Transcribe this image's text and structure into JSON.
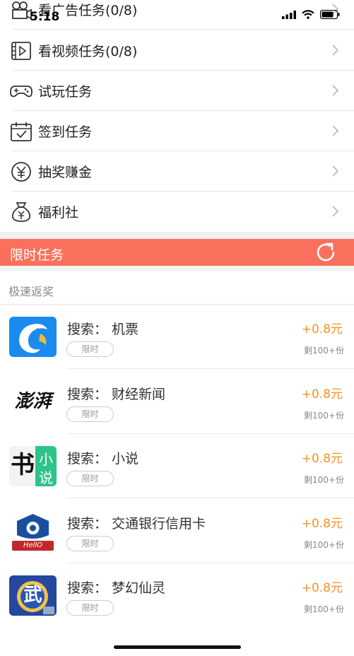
{
  "status_bar": {
    "time": "5:18"
  },
  "tasks": [
    {
      "label": "看广告任务(0/8)",
      "icon": "camera-icon"
    },
    {
      "label": "看视频任务(0/8)",
      "icon": "video-icon"
    },
    {
      "label": "试玩任务",
      "icon": "gamepad-icon"
    },
    {
      "label": "签到任务",
      "icon": "calendar-check-icon"
    },
    {
      "label": "抽奖赚金",
      "icon": "yen-coin-icon"
    },
    {
      "label": "福利社",
      "icon": "money-bag-icon"
    }
  ],
  "limited": {
    "title": "限时任务"
  },
  "section": {
    "label": "极速返奖"
  },
  "offers": [
    {
      "title": "搜索：  机票",
      "tag": "限时",
      "reward": "+0.8元",
      "remaining": "剩100+份",
      "icon": "dolphin-app-icon"
    },
    {
      "title": "搜索：  财经新闻",
      "tag": "限时",
      "reward": "+0.8元",
      "remaining": "剩100+份",
      "icon": "pengpai-app-icon",
      "icon_text": "澎湃"
    },
    {
      "title": "搜索：  小说",
      "tag": "限时",
      "reward": "+0.8元",
      "remaining": "剩100+份",
      "icon": "novel-app-icon",
      "icon_text": [
        "书",
        "小",
        "说"
      ]
    },
    {
      "title": "搜索：  交通银行信用卡",
      "tag": "限时",
      "reward": "+0.8元",
      "remaining": "剩100+份",
      "icon": "bank-app-icon",
      "icon_text": "HellO"
    },
    {
      "title": "搜索：  梦幻仙灵",
      "tag": "限时",
      "reward": "+0.8元",
      "remaining": "剩100+份",
      "icon": "game-app-icon",
      "icon_text": "武"
    }
  ],
  "colors": {
    "accent": "#f9715c",
    "reward": "#f29229"
  }
}
